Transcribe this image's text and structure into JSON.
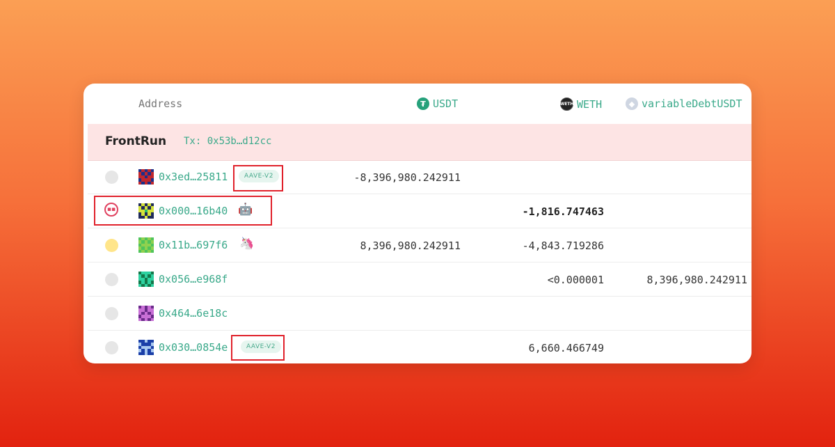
{
  "header": {
    "address_label": "Address",
    "columns": [
      {
        "label": "USDT",
        "icon": "tether-icon"
      },
      {
        "label": "WETH",
        "icon": "weth-icon"
      },
      {
        "label": "variableDebtUSDT",
        "icon": "ethereum-icon"
      }
    ]
  },
  "group": {
    "title": "FrontRun",
    "tx": "Tx: 0x53b…d12cc"
  },
  "rows": [
    {
      "address": "0x3ed…25811",
      "tag": "AAVE-V2",
      "usdt": "-8,396,980.242911",
      "weth": "",
      "vdebt": ""
    },
    {
      "address": "0x000…16b40",
      "emoji": "🤖",
      "usdt": "",
      "weth": "-1,816.747463",
      "vdebt": ""
    },
    {
      "address": "0x11b…697f6",
      "emoji": "🦄",
      "usdt": "8,396,980.242911",
      "weth": "-4,843.719286",
      "vdebt": ""
    },
    {
      "address": "0x056…e968f",
      "usdt": "",
      "weth": "<0.000001",
      "vdebt": "8,396,980.242911"
    },
    {
      "address": "0x464…6e18c",
      "usdt": "",
      "weth": "",
      "vdebt": ""
    },
    {
      "address": "0x030…0854e",
      "tag": "AAVE-V2",
      "usdt": "",
      "weth": "6,660.466749",
      "vdebt": ""
    }
  ],
  "colors": {
    "accent_green": "#3aa98a",
    "group_bg": "#fde4e4",
    "highlight_red": "#e0202a"
  }
}
